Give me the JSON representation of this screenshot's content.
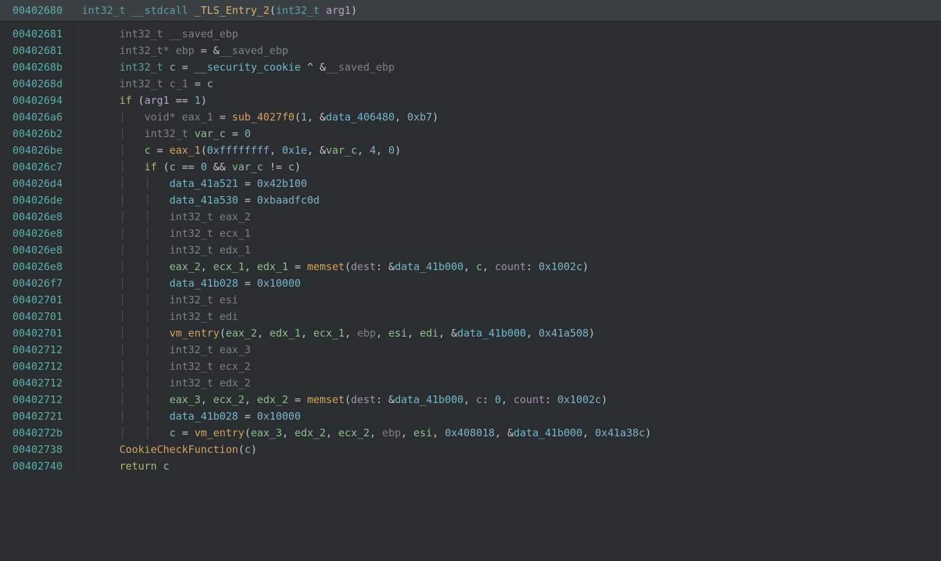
{
  "header": {
    "address": "00402680",
    "code_html": "<span class='t-type-b'>int32_t</span> <span class='t-type-b'>__stdcall</span> <span class='t-func'>_TLS_Entry_2</span><span class='t-op'>(</span><span class='t-type-b'>int32_t</span> <span class='t-param'>arg1</span><span class='t-op'>)</span>"
  },
  "lines": [
    {
      "addr": "00402681",
      "indent": 1,
      "html": "<span class='t-type'>int32_t</span> <span class='t-muted'>__saved_ebp</span>"
    },
    {
      "addr": "00402681",
      "indent": 1,
      "html": "<span class='t-type'>int32_t*</span> <span class='t-muted'>ebp</span> <span class='t-op'>=</span> <span class='t-op'>&amp;</span><span class='t-muted'>__saved_ebp</span>"
    },
    {
      "addr": "0040268b",
      "indent": 1,
      "html": "<span class='t-type-b'>int32_t</span> <span class='t-var'>c</span> <span class='t-op'>=</span> <span class='t-data'>__security_cookie</span> <span class='t-op'>^</span> <span class='t-op'>&amp;</span><span class='t-muted'>__saved_ebp</span>"
    },
    {
      "addr": "0040268d",
      "indent": 1,
      "html": "<span class='t-type'>int32_t</span> <span class='t-muted'>c_1</span> <span class='t-op'>=</span> <span class='t-var'>c</span>"
    },
    {
      "addr": "00402694",
      "indent": 1,
      "html": "<span class='t-kw'>if</span> <span class='t-op'>(</span><span class='t-param'>arg1</span> <span class='t-op'>==</span> <span class='t-num'>1</span><span class='t-op'>)</span>"
    },
    {
      "addr": "004026a6",
      "indent": 2,
      "html": "<span class='t-type'>void*</span> <span class='t-muted'>eax_1</span> <span class='t-op'>=</span> <span class='t-call'>sub_4027f0</span><span class='t-op'>(</span><span class='t-num'>1</span><span class='t-op'>,</span> <span class='t-op'>&amp;</span><span class='t-data'>data_406480</span><span class='t-op'>,</span> <span class='t-num'>0xb7</span><span class='t-op'>)</span>"
    },
    {
      "addr": "004026b2",
      "indent": 2,
      "html": "<span class='t-type'>int32_t</span> <span class='t-var'>var_c</span> <span class='t-op'>=</span> <span class='t-num'>0</span>"
    },
    {
      "addr": "004026be",
      "indent": 2,
      "html": "<span class='t-var'>c</span> <span class='t-op'>=</span> <span class='t-call'>eax_1</span><span class='t-op'>(</span><span class='t-num'>0xffffffff</span><span class='t-op'>,</span> <span class='t-num'>0x1e</span><span class='t-op'>,</span> <span class='t-op'>&amp;</span><span class='t-var'>var_c</span><span class='t-op'>,</span> <span class='t-num'>4</span><span class='t-op'>,</span> <span class='t-num'>0</span><span class='t-op'>)</span>"
    },
    {
      "addr": "004026c7",
      "indent": 2,
      "html": "<span class='t-kw'>if</span> <span class='t-op'>(</span><span class='t-var'>c</span> <span class='t-op'>==</span> <span class='t-num'>0</span> <span class='t-op'>&amp;&amp;</span> <span class='t-var'>var_c</span> <span class='t-op'>!=</span> <span class='t-var'>c</span><span class='t-op'>)</span>"
    },
    {
      "addr": "004026d4",
      "indent": 3,
      "html": "<span class='t-data'>data_41a521</span> <span class='t-op'>=</span> <span class='t-num'>0x42b100</span>"
    },
    {
      "addr": "004026de",
      "indent": 3,
      "html": "<span class='t-data'>data_41a530</span> <span class='t-op'>=</span> <span class='t-num'>0xbaadfc0d</span>"
    },
    {
      "addr": "004026e8",
      "indent": 3,
      "html": "<span class='t-type'>int32_t</span> <span class='t-muted'>eax_2</span>"
    },
    {
      "addr": "004026e8",
      "indent": 3,
      "html": "<span class='t-type'>int32_t</span> <span class='t-muted'>ecx_1</span>"
    },
    {
      "addr": "004026e8",
      "indent": 3,
      "html": "<span class='t-type'>int32_t</span> <span class='t-muted'>edx_1</span>"
    },
    {
      "addr": "004026e8",
      "indent": 3,
      "html": "<span class='t-var'>eax_2</span><span class='t-op'>,</span> <span class='t-var'>ecx_1</span><span class='t-op'>,</span> <span class='t-var'>edx_1</span> <span class='t-op'>=</span> <span class='t-call'>memset</span><span class='t-op'>(</span><span class='t-named'>dest</span><span class='t-op'>:</span> <span class='t-op'>&amp;</span><span class='t-data'>data_41b000</span><span class='t-op'>,</span> <span class='t-var'>c</span><span class='t-op'>,</span> <span class='t-named'>count</span><span class='t-op'>:</span> <span class='t-num'>0x1002c</span><span class='t-op'>)</span>"
    },
    {
      "addr": "004026f7",
      "indent": 3,
      "html": "<span class='t-data'>data_41b028</span> <span class='t-op'>=</span> <span class='t-num'>0x10000</span>"
    },
    {
      "addr": "00402701",
      "indent": 3,
      "html": "<span class='t-type'>int32_t</span> <span class='t-muted'>esi</span>"
    },
    {
      "addr": "00402701",
      "indent": 3,
      "html": "<span class='t-type'>int32_t</span> <span class='t-muted'>edi</span>"
    },
    {
      "addr": "00402701",
      "indent": 3,
      "html": "<span class='t-call'>vm_entry</span><span class='t-op'>(</span><span class='t-var'>eax_2</span><span class='t-op'>,</span> <span class='t-var'>edx_1</span><span class='t-op'>,</span> <span class='t-var'>ecx_1</span><span class='t-op'>,</span> <span class='t-muted'>ebp</span><span class='t-op'>,</span> <span class='t-var'>esi</span><span class='t-op'>,</span> <span class='t-var'>edi</span><span class='t-op'>,</span> <span class='t-op'>&amp;</span><span class='t-data'>data_41b000</span><span class='t-op'>,</span> <span class='t-num'>0x41a508</span><span class='t-op'>)</span>"
    },
    {
      "addr": "00402712",
      "indent": 3,
      "html": "<span class='t-type'>int32_t</span> <span class='t-muted'>eax_3</span>"
    },
    {
      "addr": "00402712",
      "indent": 3,
      "html": "<span class='t-type'>int32_t</span> <span class='t-muted'>ecx_2</span>"
    },
    {
      "addr": "00402712",
      "indent": 3,
      "html": "<span class='t-type'>int32_t</span> <span class='t-muted'>edx_2</span>"
    },
    {
      "addr": "00402712",
      "indent": 3,
      "html": "<span class='t-var'>eax_3</span><span class='t-op'>,</span> <span class='t-var'>ecx_2</span><span class='t-op'>,</span> <span class='t-var'>edx_2</span> <span class='t-op'>=</span> <span class='t-call'>memset</span><span class='t-op'>(</span><span class='t-named'>dest</span><span class='t-op'>:</span> <span class='t-op'>&amp;</span><span class='t-data'>data_41b000</span><span class='t-op'>,</span> <span class='t-named'>c</span><span class='t-op'>:</span> <span class='t-num'>0</span><span class='t-op'>,</span> <span class='t-named'>count</span><span class='t-op'>:</span> <span class='t-num'>0x1002c</span><span class='t-op'>)</span>"
    },
    {
      "addr": "00402721",
      "indent": 3,
      "html": "<span class='t-data'>data_41b028</span> <span class='t-op'>=</span> <span class='t-num'>0x10000</span>"
    },
    {
      "addr": "0040272b",
      "indent": 3,
      "html": "<span class='t-var'>c</span> <span class='t-op'>=</span> <span class='t-call'>vm_entry</span><span class='t-op'>(</span><span class='t-var'>eax_3</span><span class='t-op'>,</span> <span class='t-var'>edx_2</span><span class='t-op'>,</span> <span class='t-var'>ecx_2</span><span class='t-op'>,</span> <span class='t-muted'>ebp</span><span class='t-op'>,</span> <span class='t-var'>esi</span><span class='t-op'>,</span> <span class='t-num'>0x408018</span><span class='t-op'>,</span> <span class='t-op'>&amp;</span><span class='t-data'>data_41b000</span><span class='t-op'>,</span> <span class='t-num'>0x41a38c</span><span class='t-op'>)</span>"
    },
    {
      "addr": "00402738",
      "indent": 1,
      "html": "<span class='t-call'>CookieCheckFunction</span><span class='t-op'>(</span><span class='t-var'>c</span><span class='t-op'>)</span>"
    },
    {
      "addr": "00402740",
      "indent": 1,
      "html": "<span class='t-kw'>return</span> <span class='t-var'>c</span>"
    }
  ]
}
